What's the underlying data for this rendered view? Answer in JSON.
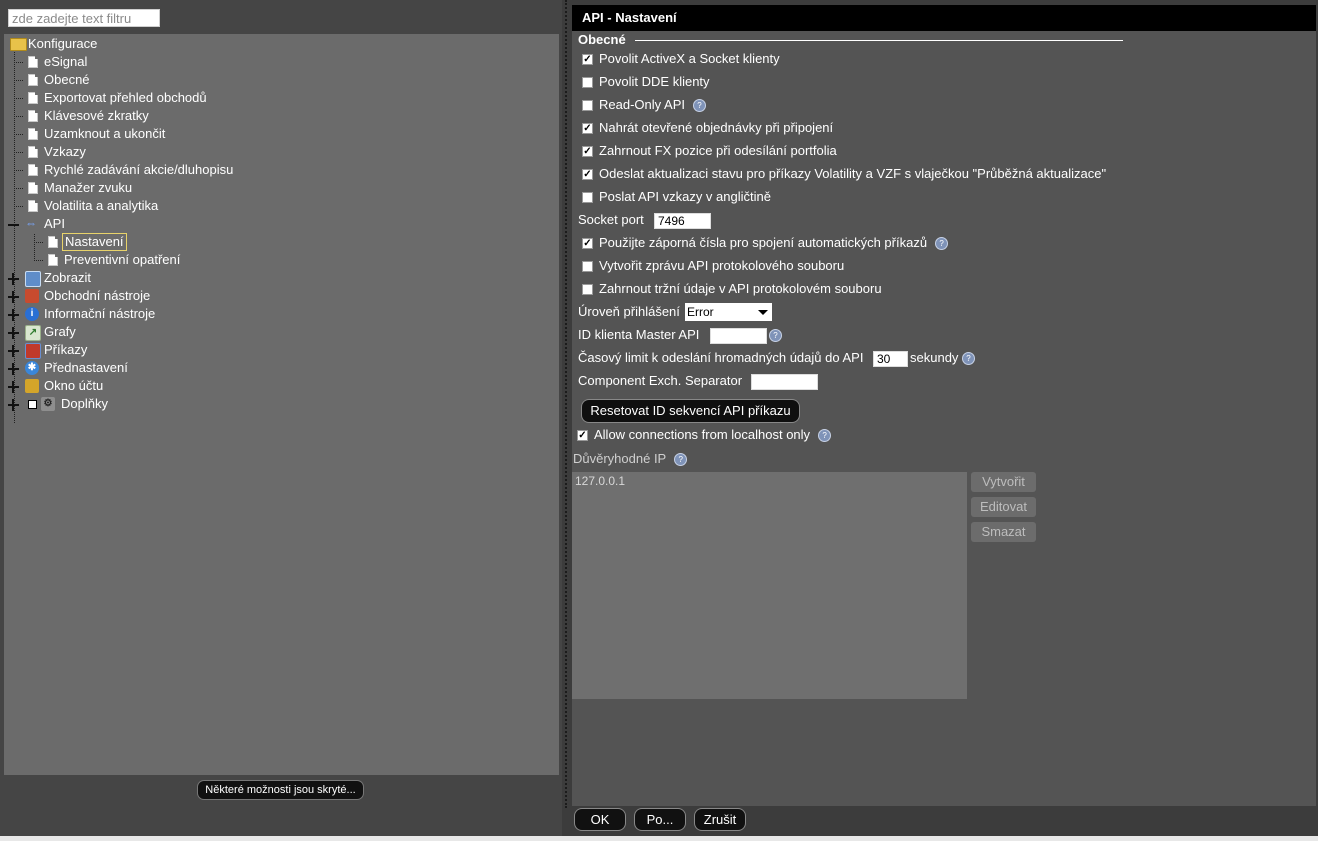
{
  "filter": {
    "placeholder": "zde zadejte text filtru"
  },
  "tree": {
    "root_label": "Konfigurace",
    "children": [
      {
        "label": "eSignal"
      },
      {
        "label": "Obecné"
      },
      {
        "label": "Exportovat přehled obchodů"
      },
      {
        "label": "Klávesové zkratky"
      },
      {
        "label": "Uzamknout a ukončit"
      },
      {
        "label": "Vzkazy"
      },
      {
        "label": "Rychlé zadávání akcie/dluhopisu"
      },
      {
        "label": "Manažer zvuku"
      },
      {
        "label": "Volatilita a analytika"
      }
    ],
    "api": {
      "label": "API",
      "children": [
        {
          "label": "Nastavení",
          "selected": true
        },
        {
          "label": "Preventivní opatření"
        }
      ]
    },
    "categories": [
      {
        "label": "Zobrazit",
        "icon": "display-icon"
      },
      {
        "label": "Obchodní nástroje",
        "icon": "trading-tools-icon"
      },
      {
        "label": "Informační nástroje",
        "icon": "info-icon"
      },
      {
        "label": "Grafy",
        "icon": "chart-icon"
      },
      {
        "label": "Příkazy",
        "icon": "orders-icon"
      },
      {
        "label": "Přednastavení",
        "icon": "presets-icon"
      },
      {
        "label": "Okno účtu",
        "icon": "account-window-icon"
      },
      {
        "label": "Doplňky",
        "icon": "addons-icon"
      }
    ],
    "hidden_options_label": "Některé možnosti jsou skryté..."
  },
  "panel": {
    "title": "API - Nastavení",
    "section": "Obecné",
    "checkboxes": [
      {
        "label": "Povolit ActiveX a Socket klienty",
        "checked": true,
        "help": false
      },
      {
        "label": "Povolit DDE klienty",
        "checked": false,
        "help": false
      },
      {
        "label": "Read-Only API",
        "checked": false,
        "help": true
      },
      {
        "label": "Nahrát otevřené objednávky při připojení",
        "checked": true,
        "help": false
      },
      {
        "label": "Zahrnout FX pozice při odesílání portfolia",
        "checked": true,
        "help": false
      },
      {
        "label": "Odeslat aktualizaci stavu pro příkazy Volatility a VZF s vlaječkou \"Průběžná aktualizace\"",
        "checked": true,
        "help": false
      },
      {
        "label": "Poslat API vzkazy v angličtině",
        "checked": false,
        "help": false
      }
    ],
    "socket_port": {
      "label": "Socket port",
      "value": "7496"
    },
    "checkboxes2": [
      {
        "label": "Použijte záporná čísla pro spojení automatických příkazů",
        "checked": true,
        "help": true
      },
      {
        "label": "Vytvořit zprávu API protokolového souboru",
        "checked": false,
        "help": false
      },
      {
        "label": "Zahrnout tržní údaje v API protokolovém souboru",
        "checked": false,
        "help": false
      }
    ],
    "log_level": {
      "label": "Úroveň přihlášení",
      "value": "Error"
    },
    "master_client_id": {
      "label": "ID klienta Master API",
      "value": ""
    },
    "timeout": {
      "label": "Časový limit k odeslání hromadných údajů do API",
      "value": "30",
      "unit": "sekundy"
    },
    "component_sep": {
      "label": "Component Exch. Separator",
      "value": ""
    },
    "reset_button": "Resetovat ID sekvencí API příkazu",
    "localhost_only": {
      "label": "Allow connections from localhost only",
      "checked": true
    },
    "trusted_ip": {
      "label": "Důvěryhodné IP",
      "items": [
        "127.0.0.1"
      ],
      "buttons": {
        "create": "Vytvořit",
        "edit": "Editovat",
        "delete": "Smazat"
      }
    }
  },
  "footer": {
    "ok": "OK",
    "apply": "Po...",
    "cancel": "Zrušit"
  }
}
